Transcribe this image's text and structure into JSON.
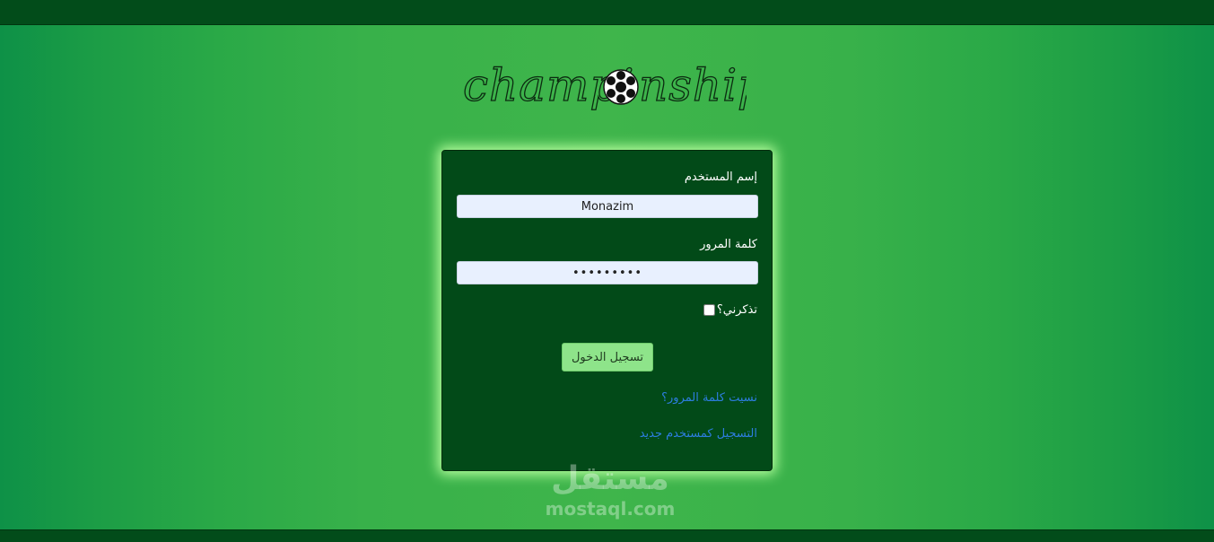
{
  "logo": {
    "text_left": "champi",
    "text_right": "nship"
  },
  "login": {
    "username_label": "إسم المستخدم",
    "username_value": "Monazim",
    "password_label": "كلمة المرور",
    "password_value": "•••••••••",
    "remember_label": "تذكرني؟",
    "submit_label": "تسجيل الدخول",
    "forgot_link": "نسيت كلمة المرور؟",
    "register_link": "التسجيل كمستخدم جديد"
  },
  "watermark": {
    "arabic": "مستقل",
    "latin": "mostaql.com"
  },
  "colors": {
    "bar": "#024c1a",
    "panel": "#024a18",
    "button": "#8ee48a",
    "link": "#2d7de0"
  }
}
